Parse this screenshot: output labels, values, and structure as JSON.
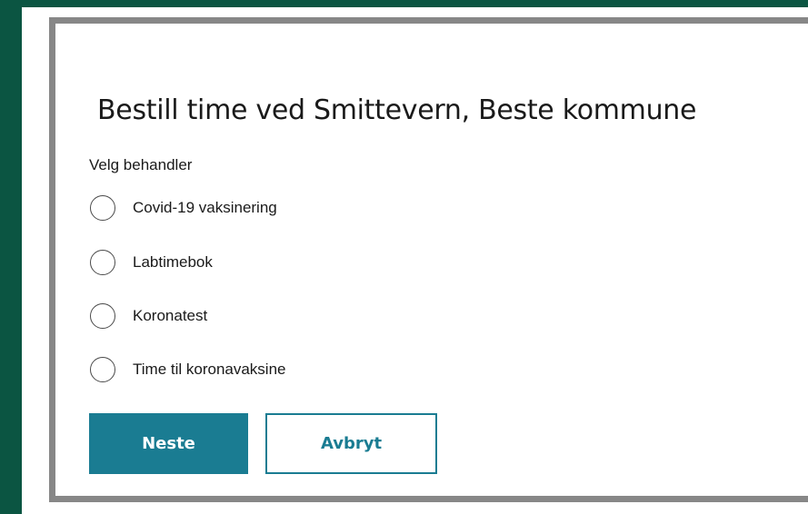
{
  "colors": {
    "frame_green": "#0b5542",
    "dialog_border": "#878787",
    "primary": "#1a7c92",
    "text": "#1a1a1a"
  },
  "dialog": {
    "title": "Bestill time ved Smittevern, Beste kommune"
  },
  "treatment": {
    "label": "Velg behandler",
    "options": [
      {
        "label": "Covid-19 vaksinering",
        "selected": false
      },
      {
        "label": "Labtimebok",
        "selected": false
      },
      {
        "label": "Koronatest",
        "selected": false
      },
      {
        "label": "Time til koronavaksine",
        "selected": false
      }
    ]
  },
  "actions": {
    "next_label": "Neste",
    "cancel_label": "Avbryt"
  }
}
